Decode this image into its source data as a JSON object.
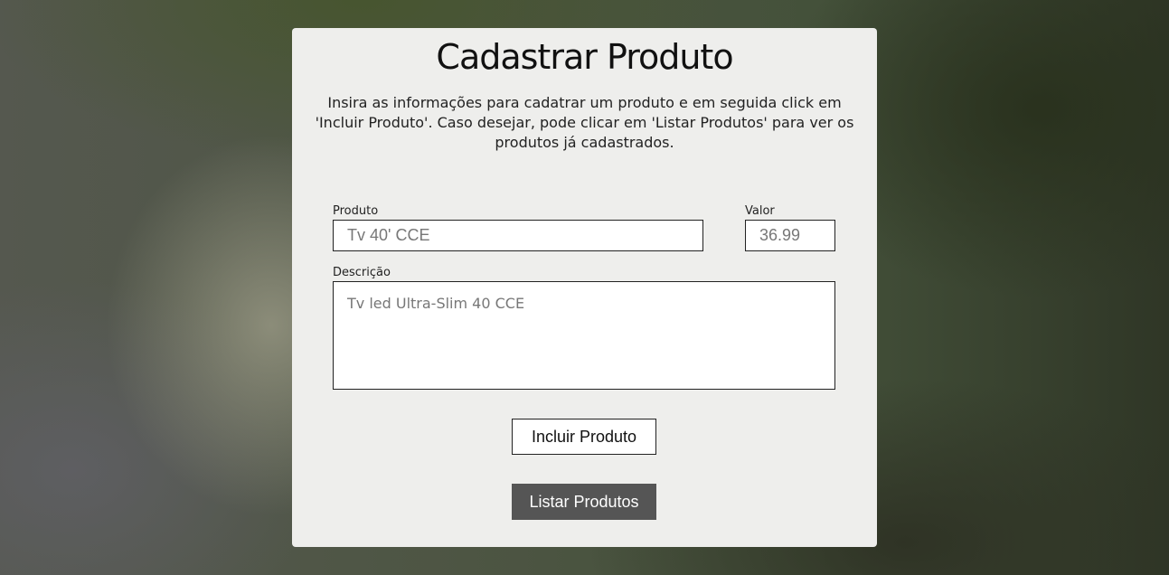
{
  "page": {
    "title": "Cadastrar Produto",
    "intro_line1": "Insira as informações para cadatrar um produto e em seguida click em",
    "intro_line2": "'Incluir Produto'. Caso desejar, pode clicar em 'Listar Produtos' para ver os",
    "intro_line3": "produtos já cadastrados."
  },
  "form": {
    "produto": {
      "label": "Produto",
      "value": "",
      "placeholder": "Tv 40' CCE"
    },
    "valor": {
      "label": "Valor",
      "value": "",
      "placeholder": "36.99"
    },
    "descricao": {
      "label": "Descrição",
      "value": "",
      "placeholder": "Tv led Ultra-Slim 40 CCE"
    }
  },
  "actions": {
    "include_label": "Incluir Produto",
    "list_label": "Listar Produtos"
  },
  "colors": {
    "card_background": "#eeeeec",
    "list_button_background": "#555555",
    "list_button_text": "#ffffff",
    "include_button_background": "#ffffff"
  }
}
